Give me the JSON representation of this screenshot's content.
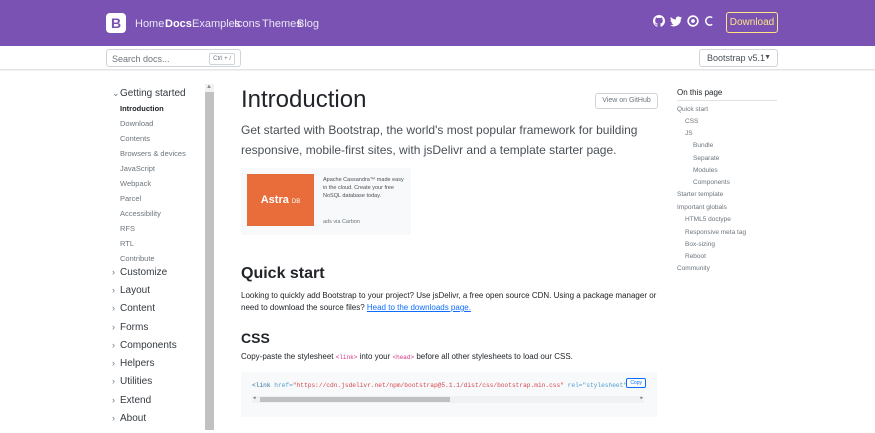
{
  "navbar": {
    "brand": "B",
    "links": [
      "Home",
      "Docs",
      "Examples",
      "Icons",
      "Themes",
      "Blog"
    ],
    "active": "Docs",
    "icons": [
      "github-icon",
      "twitter-icon",
      "opencollective-icon",
      "slack-icon"
    ],
    "download_label": "Download"
  },
  "subnav": {
    "search_placeholder": "Search docs...",
    "search_shortcut": "Ctrl + /",
    "version": "Bootstrap v5.1"
  },
  "sidebar": {
    "groups": [
      {
        "label": "Getting started",
        "expanded": true,
        "items": [
          "Introduction",
          "Download",
          "Contents",
          "Browsers & devices",
          "JavaScript",
          "Webpack",
          "Parcel",
          "Accessibility",
          "RFS",
          "RTL",
          "Contribute"
        ]
      },
      {
        "label": "Customize"
      },
      {
        "label": "Layout"
      },
      {
        "label": "Content"
      },
      {
        "label": "Forms"
      },
      {
        "label": "Components"
      },
      {
        "label": "Helpers"
      },
      {
        "label": "Utilities"
      },
      {
        "label": "Extend"
      },
      {
        "label": "About"
      }
    ],
    "active_item": "Introduction"
  },
  "main": {
    "title": "Introduction",
    "github_button": "View on GitHub",
    "lead": "Get started with Bootstrap, the world's most popular framework for building responsive, mobile-first sites, with jsDelivr and a template starter page.",
    "ad": {
      "logo": "Astra",
      "logo_suffix": "DB",
      "text": "Apache Cassandra™ made easy in the cloud. Create your free NoSQL database today.",
      "by": "ads via Carbon"
    },
    "quick_start": {
      "heading": "Quick start",
      "text": "Looking to quickly add Bootstrap to your project? Use jsDelivr, a free open source CDN. Using a package manager or need to download the source files?",
      "link": "Head to the downloads page."
    },
    "css": {
      "heading": "CSS",
      "text_before": "Copy-paste the stylesheet",
      "code1": "<link>",
      "text_middle": "into your",
      "code2": "<head>",
      "text_after": "before all other stylesheets to load our CSS.",
      "snippet_tag": "<link",
      "snippet_href_attr": "href=",
      "snippet_href": "\"https://cdn.jsdelivr.net/npm/bootstrap@5.1.1/dist/css/bootstrap.min.css\"",
      "snippet_rel": "rel=\"stylesheet\"",
      "copy_label": "Copy"
    }
  },
  "toc": {
    "title": "On this page",
    "items": [
      {
        "label": "Quick start",
        "level": 0
      },
      {
        "label": "CSS",
        "level": 1
      },
      {
        "label": "JS",
        "level": 1
      },
      {
        "label": "Bundle",
        "level": 2
      },
      {
        "label": "Separate",
        "level": 2
      },
      {
        "label": "Modules",
        "level": 2
      },
      {
        "label": "Components",
        "level": 2
      },
      {
        "label": "Starter template",
        "level": 0
      },
      {
        "label": "Important globals",
        "level": 0
      },
      {
        "label": "HTML5 doctype",
        "level": 1
      },
      {
        "label": "Responsive meta tag",
        "level": 1
      },
      {
        "label": "Box-sizing",
        "level": 1
      },
      {
        "label": "Reboot",
        "level": 1
      },
      {
        "label": "Community",
        "level": 0
      }
    ]
  }
}
